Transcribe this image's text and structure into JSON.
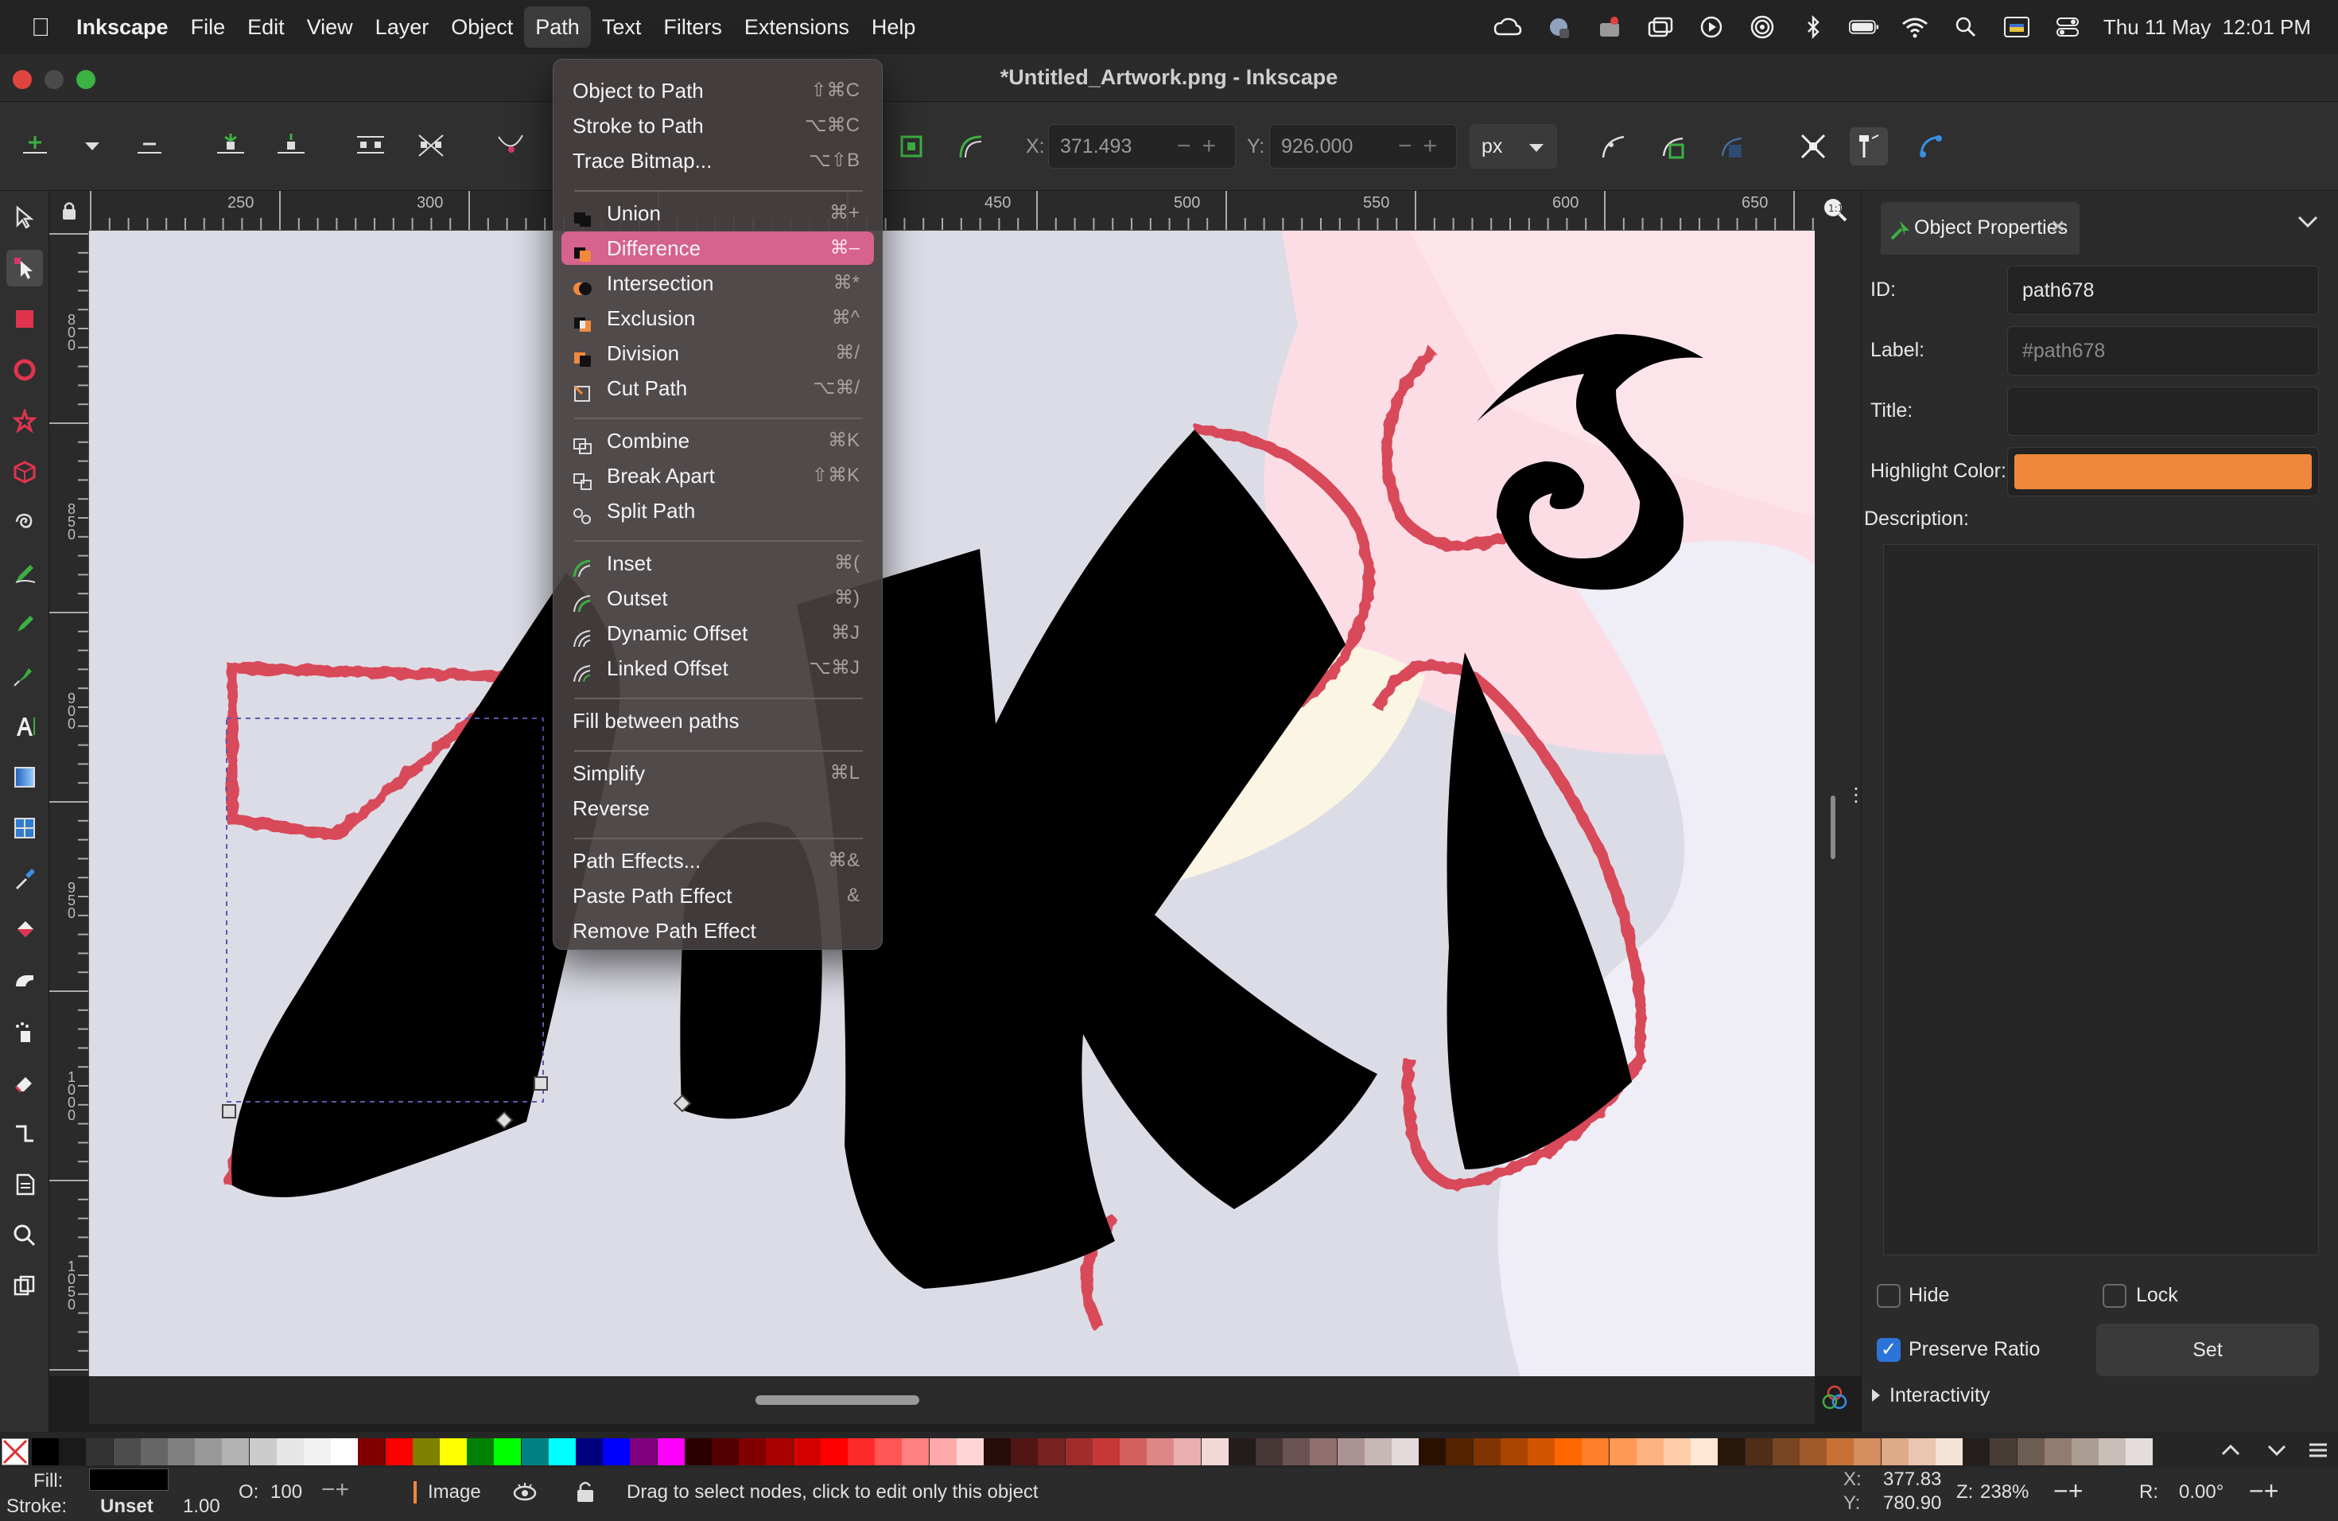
{
  "menubar": {
    "app_name": "Inkscape",
    "items": [
      "File",
      "Edit",
      "View",
      "Layer",
      "Object",
      "Path",
      "Text",
      "Filters",
      "Extensions",
      "Help"
    ],
    "active_item": "Path",
    "datetime": "Thu 11 May  12:01 PM"
  },
  "window": {
    "title": "*Untitled_Artwork.png - Inkscape"
  },
  "tool_controls": {
    "x_label": "X:",
    "x_value": "371.493",
    "y_label": "Y:",
    "y_value": "926.000",
    "unit": "px"
  },
  "rulers": {
    "horizontal": [
      "250",
      "300",
      "450",
      "500",
      "550",
      "600",
      "650"
    ],
    "vertical": [
      "800",
      "850",
      "900",
      "950",
      "1000",
      "1050"
    ]
  },
  "path_menu": {
    "groups": [
      [
        {
          "label": "Object to Path",
          "shortcut": "⇧⌘C"
        },
        {
          "label": "Stroke to Path",
          "shortcut": "⌥⌘C"
        },
        {
          "label": "Trace Bitmap...",
          "shortcut": "⌥⇧B"
        }
      ],
      [
        {
          "label": "Union",
          "shortcut": "⌘+",
          "icon": "union-icon"
        },
        {
          "label": "Difference",
          "shortcut": "⌘–",
          "icon": "difference-icon",
          "highlighted": true
        },
        {
          "label": "Intersection",
          "shortcut": "⌘*",
          "icon": "intersection-icon"
        },
        {
          "label": "Exclusion",
          "shortcut": "⌘^",
          "icon": "exclusion-icon"
        },
        {
          "label": "Division",
          "shortcut": "⌘/",
          "icon": "division-icon"
        },
        {
          "label": "Cut Path",
          "shortcut": "⌥⌘/",
          "icon": "cut-path-icon"
        }
      ],
      [
        {
          "label": "Combine",
          "shortcut": "⌘K",
          "icon": "combine-icon"
        },
        {
          "label": "Break Apart",
          "shortcut": "⇧⌘K",
          "icon": "break-apart-icon"
        },
        {
          "label": "Split Path",
          "shortcut": "",
          "icon": "split-path-icon"
        }
      ],
      [
        {
          "label": "Inset",
          "shortcut": "⌘(",
          "icon": "inset-icon"
        },
        {
          "label": "Outset",
          "shortcut": "⌘)",
          "icon": "outset-icon"
        },
        {
          "label": "Dynamic Offset",
          "shortcut": "⌘J",
          "icon": "dynamic-offset-icon"
        },
        {
          "label": "Linked Offset",
          "shortcut": "⌥⌘J",
          "icon": "linked-offset-icon"
        }
      ],
      [
        {
          "label": "Fill between paths",
          "shortcut": ""
        }
      ],
      [
        {
          "label": "Simplify",
          "shortcut": "⌘L"
        },
        {
          "label": "Reverse",
          "shortcut": ""
        }
      ],
      [
        {
          "label": "Path Effects...",
          "shortcut": "⌘&"
        },
        {
          "label": "Paste Path Effect",
          "shortcut": "&"
        },
        {
          "label": "Remove Path Effect",
          "shortcut": ""
        }
      ]
    ]
  },
  "object_properties": {
    "tab_label": "Object Properties",
    "id_label": "ID:",
    "id_value": "path678",
    "label_label": "Label:",
    "label_placeholder": "#path678",
    "title_label": "Title:",
    "title_value": "",
    "highlight_label": "Highlight Color:",
    "highlight_color": "#f0873a",
    "description_label": "Description:",
    "hide_label": "Hide",
    "hide_checked": false,
    "lock_label": "Lock",
    "lock_checked": false,
    "preserve_ratio_label": "Preserve Ratio",
    "preserve_ratio_checked": true,
    "set_button": "Set",
    "interactivity_label": "Interactivity"
  },
  "status": {
    "fill_label": "Fill:",
    "stroke_label": "Stroke:",
    "fill_color": "#000000",
    "stroke_value": "Unset",
    "stroke_width": "1.00",
    "opacity_label": "O:",
    "opacity_value": "100",
    "layer_name": "Image",
    "message": "Drag to select nodes, click to edit only this object",
    "cursor_x_label": "X:",
    "cursor_x": "377.83",
    "cursor_y_label": "Y:",
    "cursor_y": "780.90",
    "zoom_label": "Z:",
    "zoom_value": "238%",
    "rotation_label": "R:",
    "rotation_value": "0.00°"
  },
  "palette": [
    "#000000",
    "#1a1a1a",
    "#333333",
    "#4d4d4d",
    "#666666",
    "#808080",
    "#999999",
    "#b3b3b3",
    "#cccccc",
    "#e6e6e6",
    "#f2f2f2",
    "#ffffff",
    "#800000",
    "#ff0000",
    "#808000",
    "#ffff00",
    "#008000",
    "#00ff00",
    "#008080",
    "#00ffff",
    "#000080",
    "#0000ff",
    "#800080",
    "#ff00ff",
    "#2b0000",
    "#550000",
    "#800000",
    "#aa0000",
    "#d40000",
    "#ff0000",
    "#ff2a2a",
    "#ff5555",
    "#ff8080",
    "#ffaaaa",
    "#ffd5d5",
    "#280b0b",
    "#501616",
    "#782121",
    "#a02c2c",
    "#c83737",
    "#d35f5f",
    "#de8787",
    "#e9afaf",
    "#f4d7d7",
    "#241c1c",
    "#483737",
    "#6c5353",
    "#916f6f",
    "#ac9393",
    "#c8b7b7",
    "#e3dbdb",
    "#2b1100",
    "#552200",
    "#803300",
    "#aa4400",
    "#d45500",
    "#ff6600",
    "#ff7f2a",
    "#ff9955",
    "#ffb380",
    "#ffccaa",
    "#ffe6d5",
    "#28170b",
    "#502d16",
    "#784421",
    "#a05a2c",
    "#c87137",
    "#d38d5f",
    "#deaa87",
    "#e9c6af",
    "#f4e3d7",
    "#241f1c",
    "#483e37",
    "#6c5d53",
    "#917c6f",
    "#ac9d93",
    "#c8beb7",
    "#e3dedb"
  ]
}
